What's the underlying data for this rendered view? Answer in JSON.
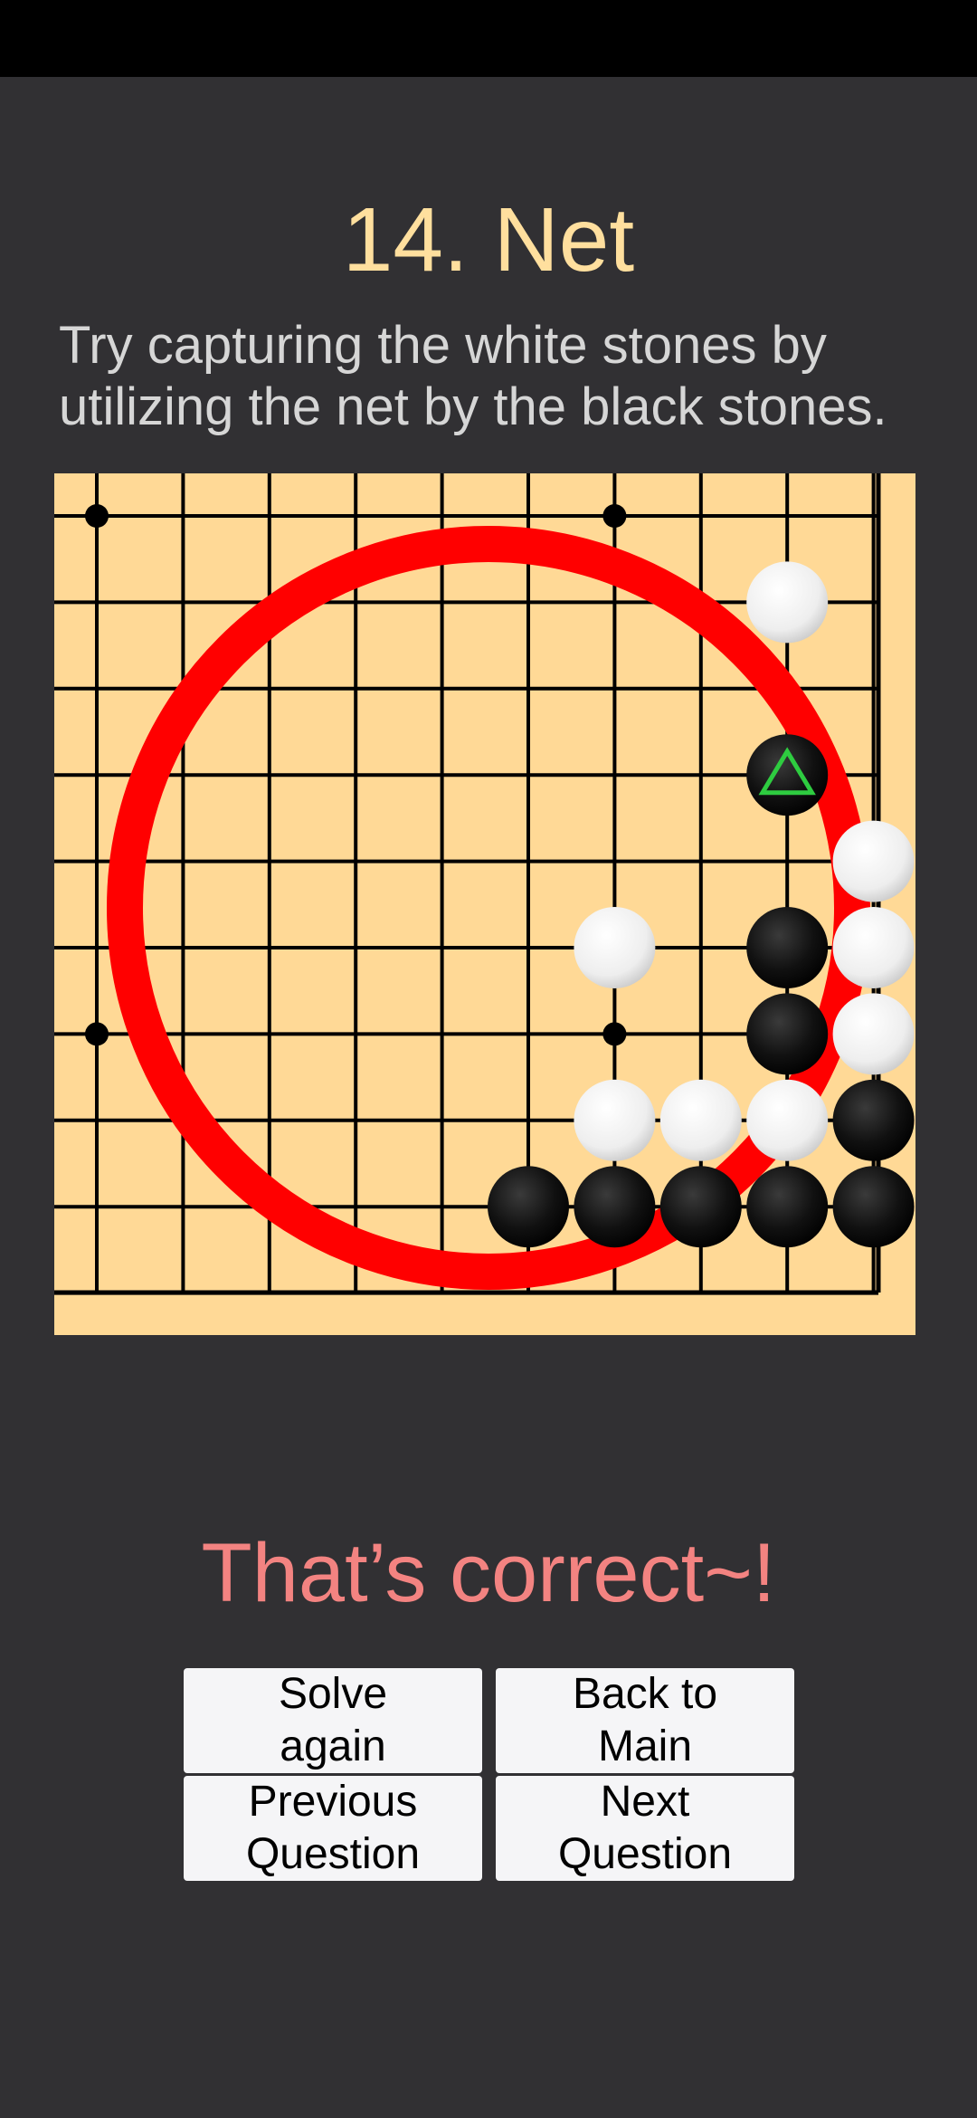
{
  "header": {
    "title": "14. Net",
    "instruction": "Try capturing the white stones by utilizing the net by the black stones."
  },
  "board": {
    "size": 10,
    "hoshi": [
      [
        0,
        0
      ],
      [
        6,
        0
      ],
      [
        0,
        6
      ],
      [
        6,
        6
      ]
    ],
    "white_stones": [
      [
        8,
        1
      ],
      [
        9,
        4
      ],
      [
        6,
        5
      ],
      [
        9,
        5
      ],
      [
        9,
        6
      ],
      [
        6,
        7
      ],
      [
        7,
        7
      ],
      [
        8,
        7
      ]
    ],
    "black_stones": [
      [
        8,
        3
      ],
      [
        8,
        5
      ],
      [
        8,
        6
      ],
      [
        9,
        7
      ],
      [
        5,
        8
      ],
      [
        6,
        8
      ],
      [
        7,
        8
      ],
      [
        8,
        8
      ],
      [
        9,
        8
      ]
    ],
    "marked_stone": [
      8,
      3
    ],
    "marker_icon": "triangle-marker-icon",
    "colors": {
      "board": "#ffd996",
      "line": "#000000",
      "net_circle": "#ff0000",
      "marker": "#2ecc40"
    }
  },
  "result": {
    "message": "That’s correct~!"
  },
  "buttons": {
    "solve_again": "Solve\n again",
    "back_to_main": "Back to\n Main",
    "previous_question": "Previous\n Question",
    "next_question": "Next\n Question"
  }
}
